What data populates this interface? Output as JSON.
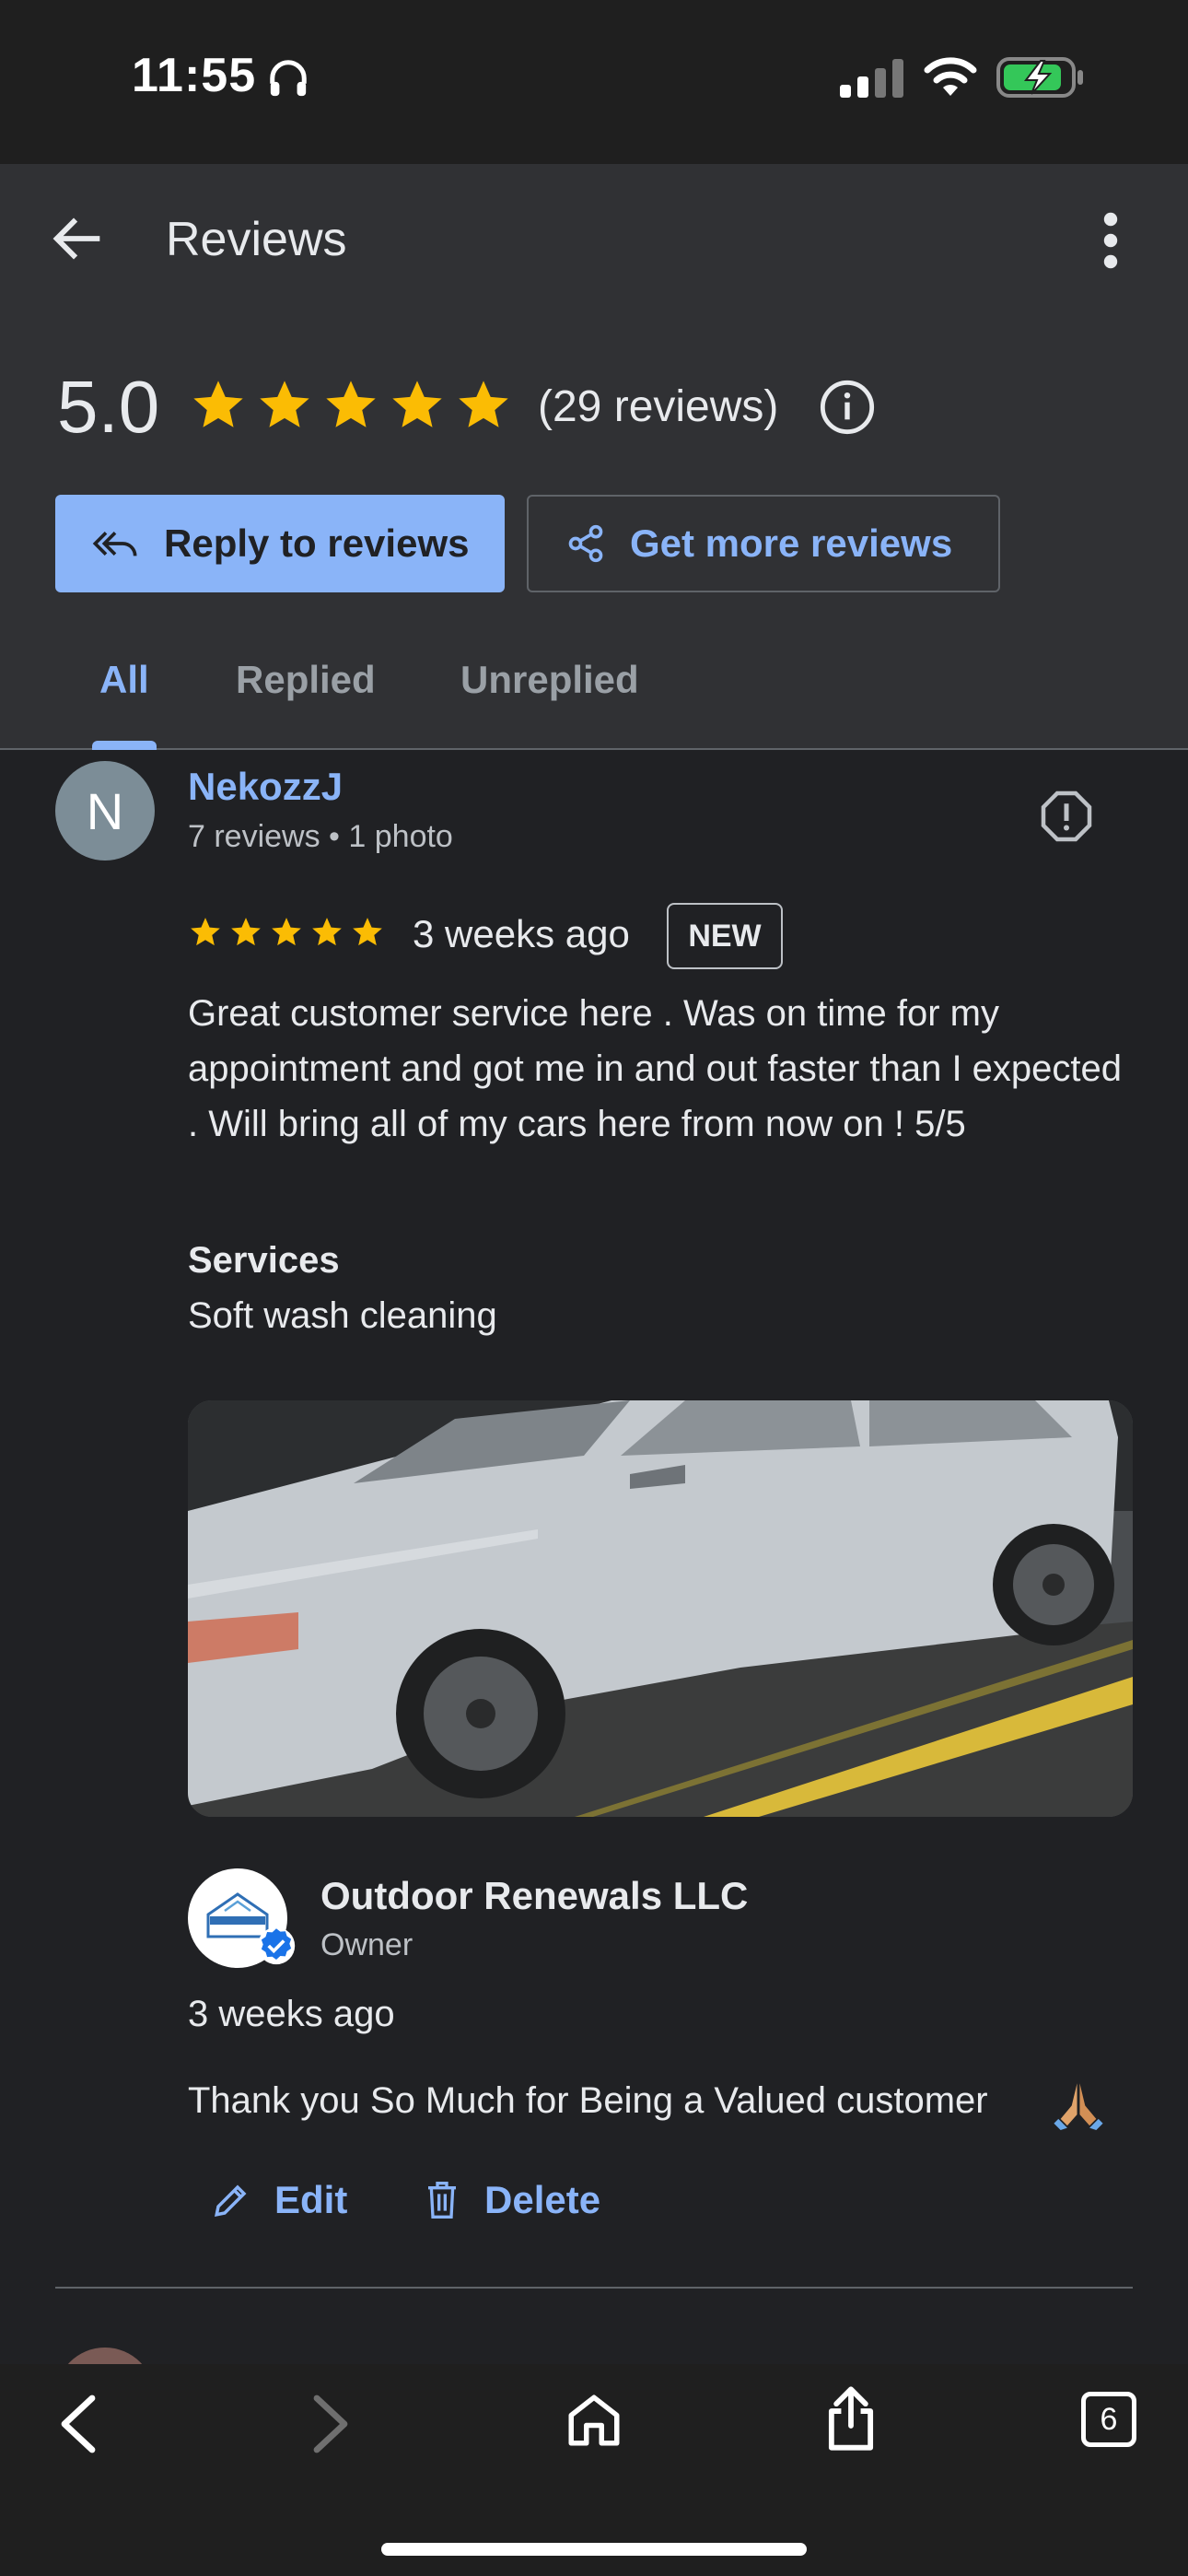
{
  "status_bar": {
    "time": "11:55"
  },
  "header": {
    "title": "Reviews"
  },
  "summary": {
    "rating": "5.0",
    "stars": 5,
    "reviews_count": "(29 reviews)",
    "reply_button": "Reply to reviews",
    "get_more_button": "Get more reviews"
  },
  "tabs": [
    {
      "label": "All",
      "selected": true
    },
    {
      "label": "Replied",
      "selected": false
    },
    {
      "label": "Unreplied",
      "selected": false
    }
  ],
  "review": {
    "avatar_letter": "N",
    "name": "NekozzJ",
    "meta": "7 reviews • 1 photo",
    "stars": 5,
    "time": "3 weeks ago",
    "badge": "NEW",
    "text": "Great customer service here . Was on time for my appointment and got me in and out faster than I expected . Will bring all of my cars here from now on ! 5/5",
    "services_label": "Services",
    "services_value": "Soft wash cleaning",
    "owner_reply": {
      "name": "Outdoor Renewals LLC",
      "role": "Owner",
      "time": "3 weeks ago",
      "text": "Thank you So Much for Being a Valued customer",
      "edit_label": "Edit",
      "delete_label": "Delete"
    }
  },
  "browser_bar": {
    "tab_count": "6"
  },
  "colors": {
    "accent": "#8ab4f8",
    "star": "#fbbc04",
    "background": "#202124",
    "header": "#303134"
  }
}
